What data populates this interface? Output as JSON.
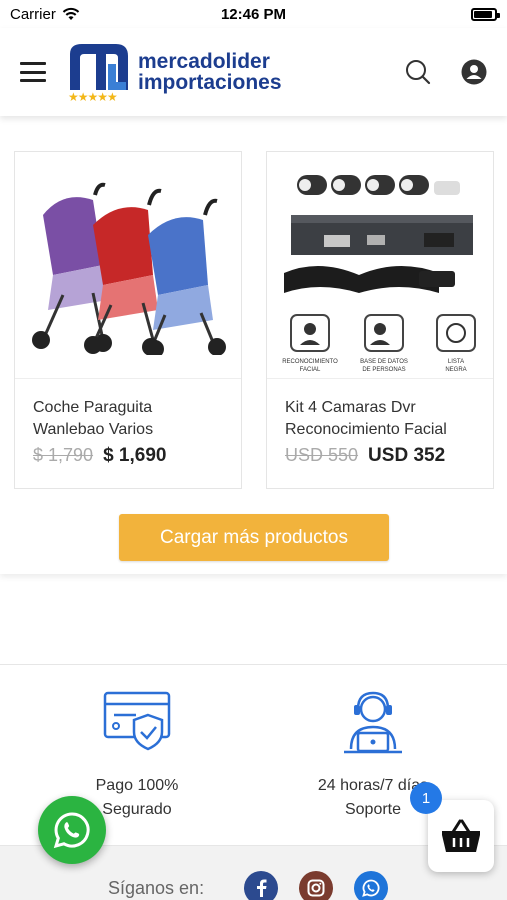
{
  "status_bar": {
    "carrier": "Carrier",
    "time": "12:46 PM",
    "battery_level": 0.9
  },
  "header": {
    "logo_line1": "mercadolider",
    "logo_line2": "importaciones",
    "logo_stars": "★★★★★",
    "brand_blue": "#1c3d8f"
  },
  "products": [
    {
      "title_line1": "Coche Paraguita",
      "title_line2": "Wanlebao Varios",
      "old_price": "$ 1,790",
      "new_price": "$ 1,690"
    },
    {
      "title_line1": "Kit 4 Camaras Dvr",
      "title_line2": "Reconocimiento Facial",
      "old_price": "USD 550",
      "new_price": "USD 352",
      "image_labels": [
        "RECONOCIMIENTO",
        "FACIAL",
        "BASE DE DATOS",
        "DE PERSONAS",
        "LISTA",
        "NEGRA"
      ]
    }
  ],
  "load_more_label": "Cargar más productos",
  "accent_color": "#f2b33c",
  "features": [
    {
      "line1": "Pago 100%",
      "line2": "Segurado",
      "icon": "secure-card-icon"
    },
    {
      "line1": "24 horas/7 días",
      "line2": "Soporte",
      "icon": "support-agent-icon"
    }
  ],
  "footer": {
    "follow_label": "Síganos en:",
    "social": [
      "facebook-icon",
      "instagram-icon",
      "whatsapp-icon"
    ]
  },
  "cart": {
    "count": "1"
  }
}
